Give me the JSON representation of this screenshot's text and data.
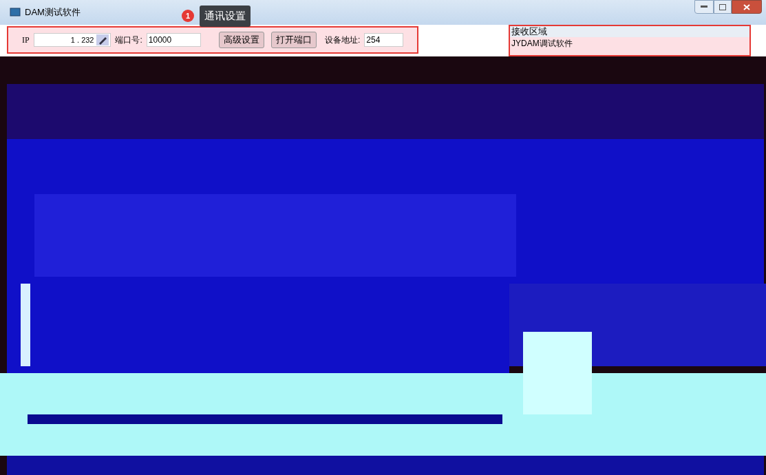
{
  "window": {
    "title": "DAM测试软件"
  },
  "callout": {
    "badge": "1",
    "text": "通讯设置"
  },
  "comm": {
    "ip_label": "IP",
    "ip_value": "1 . 232",
    "port_label": "端口号:",
    "port_value": "10000",
    "buttons": [
      "高级设置",
      "打开端口"
    ],
    "address_label": "设备地址:",
    "address_value": "254"
  },
  "receive": {
    "title": "接收区域",
    "lines": [
      "JYDAM调试软件"
    ]
  }
}
